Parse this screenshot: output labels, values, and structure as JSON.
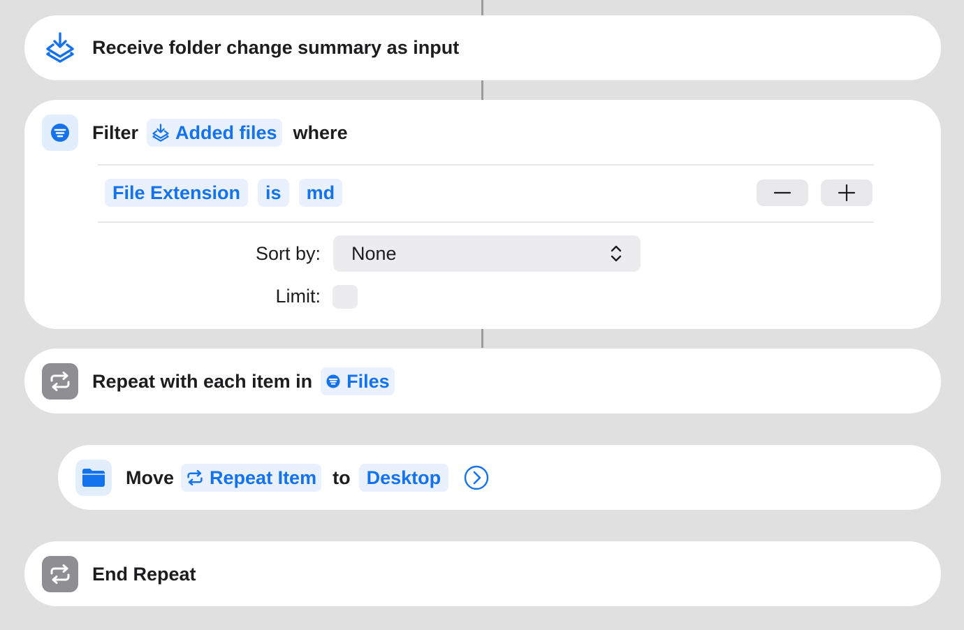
{
  "actions": {
    "receive": {
      "label": "Receive folder change summary as input",
      "icon": "receive-input-icon"
    },
    "filter": {
      "label": "Filter",
      "source_token": "Added files",
      "where_label": "where",
      "icon": "filter-icon",
      "condition": {
        "property": "File Extension",
        "operator": "is",
        "value": "md"
      },
      "remove_label": "−",
      "add_label": "+",
      "sort_label": "Sort by:",
      "sort_value": "None",
      "limit_label": "Limit:"
    },
    "repeat": {
      "label": "Repeat with each item in",
      "token": "Files",
      "icon": "repeat-icon"
    },
    "move": {
      "label": "Move",
      "item_token": "Repeat Item",
      "to_label": "to",
      "destination_token": "Desktop",
      "icon": "folder-icon"
    },
    "end_repeat": {
      "label": "End Repeat",
      "icon": "repeat-icon"
    }
  },
  "colors": {
    "accent": "#1472ec",
    "token_bg": "#e8f1fd",
    "background": "#e0e0e0",
    "card": "#ffffff",
    "gray_icon": "#8e8e93"
  }
}
